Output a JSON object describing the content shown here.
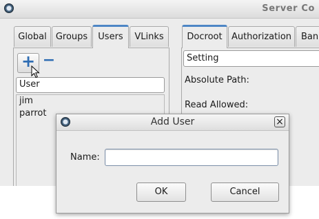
{
  "main_window": {
    "title": "Server Co",
    "icon": "app-icon"
  },
  "left_tabs": [
    {
      "label": "Global",
      "active": false
    },
    {
      "label": "Groups",
      "active": false
    },
    {
      "label": "Users",
      "active": true
    },
    {
      "label": "VLinks",
      "active": false
    }
  ],
  "users_panel": {
    "add_symbol": "+",
    "remove_symbol": "−",
    "column_header": "User",
    "users": [
      "jim",
      "parrot"
    ]
  },
  "right_tabs": [
    {
      "label": "Docroot",
      "active": true
    },
    {
      "label": "Authorization",
      "active": false
    },
    {
      "label": "Ban",
      "active": false
    }
  ],
  "docroot_panel": {
    "header": "Setting",
    "rows": [
      "Absolute Path:",
      "Read Allowed:"
    ]
  },
  "dialog": {
    "title": "Add User",
    "close_symbol": "×",
    "name_label": "Name:",
    "name_value": "",
    "name_placeholder": "",
    "ok_label": "OK",
    "cancel_label": "Cancel"
  },
  "colors": {
    "active_tab_accent": "#4d86c5",
    "add_icon": "#2f6db3"
  }
}
